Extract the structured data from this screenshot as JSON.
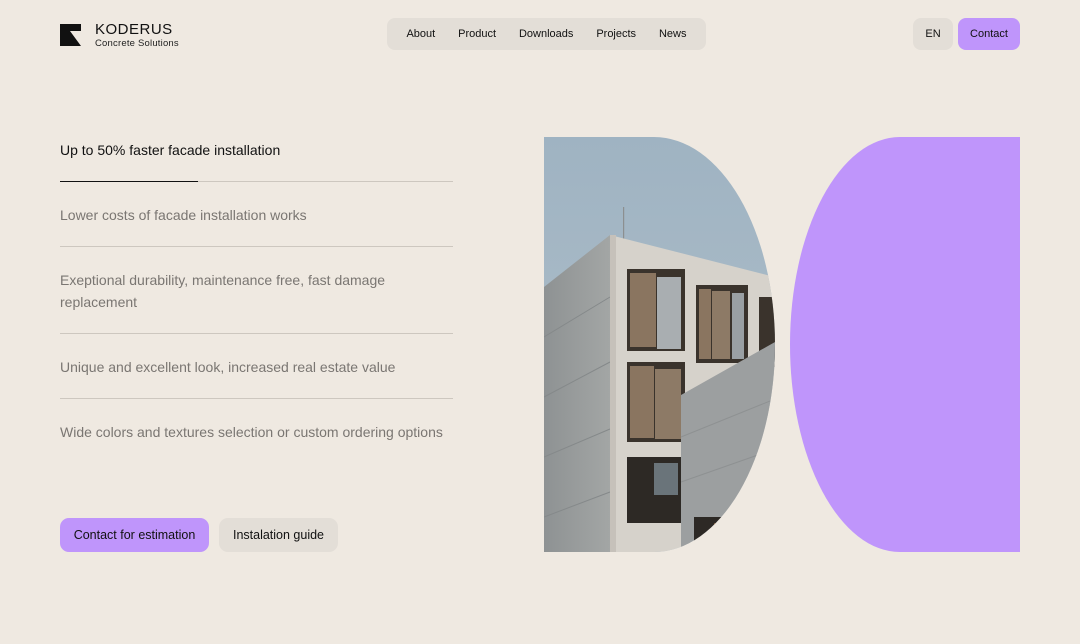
{
  "brand": {
    "name": "KODERUS",
    "tagline": "Concrete Solutions"
  },
  "nav": {
    "items": [
      {
        "label": "About"
      },
      {
        "label": "Product"
      },
      {
        "label": "Downloads"
      },
      {
        "label": "Projects"
      },
      {
        "label": "News"
      }
    ]
  },
  "header": {
    "language": "EN",
    "contact_label": "Contact"
  },
  "features": [
    {
      "text": "Up to 50% faster facade installation",
      "active": true,
      "progress": 0.35
    },
    {
      "text": "Lower costs of facade installation works",
      "active": false
    },
    {
      "text": "Exeptional durability, maintenance free, fast damage replacement",
      "active": false
    },
    {
      "text": "Unique and excellent look, increased real estate value",
      "active": false
    },
    {
      "text": "Wide colors and textures selection or custom ordering options",
      "active": false
    }
  ],
  "cta": {
    "primary_label": "Contact for estimation",
    "secondary_label": "Instalation guide"
  },
  "colors": {
    "background": "#efe9e1",
    "accent": "#bf95fb",
    "pill": "#e3ded7",
    "text": "#111111",
    "muted_text": "#7a7672"
  }
}
